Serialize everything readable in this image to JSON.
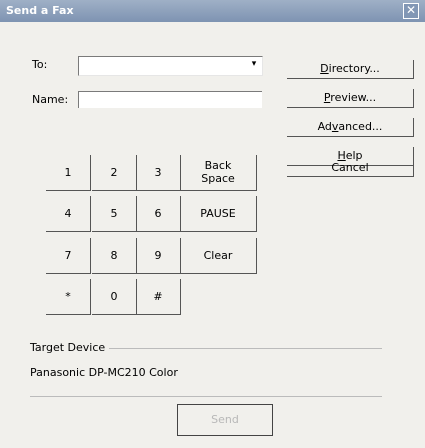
{
  "window": {
    "title": "Send a Fax",
    "close_symbol": "✕"
  },
  "form": {
    "to_label": "To:",
    "to_value": "",
    "to_dropdown_symbol": "▾",
    "name_label": "Name:",
    "name_value": ""
  },
  "side_buttons": {
    "directory": {
      "pre": "",
      "u": "D",
      "post": "irectory..."
    },
    "preview": {
      "pre": "",
      "u": "P",
      "post": "review..."
    },
    "advanced": {
      "pre": "Ad",
      "u": "v",
      "post": "anced..."
    },
    "help": {
      "pre": "",
      "u": "H",
      "post": "elp"
    },
    "cancel": "Cancel"
  },
  "keypad": {
    "keys": [
      "1",
      "2",
      "3",
      "4",
      "5",
      "6",
      "7",
      "8",
      "9",
      "*",
      "0",
      "#"
    ],
    "backspace_line1": "Back",
    "backspace_line2": "Space",
    "pause": "PAUSE",
    "clear": "Clear"
  },
  "target_device": {
    "title": "Target Device",
    "value": "Panasonic DP-MC210 Color"
  },
  "send_label": "Send"
}
